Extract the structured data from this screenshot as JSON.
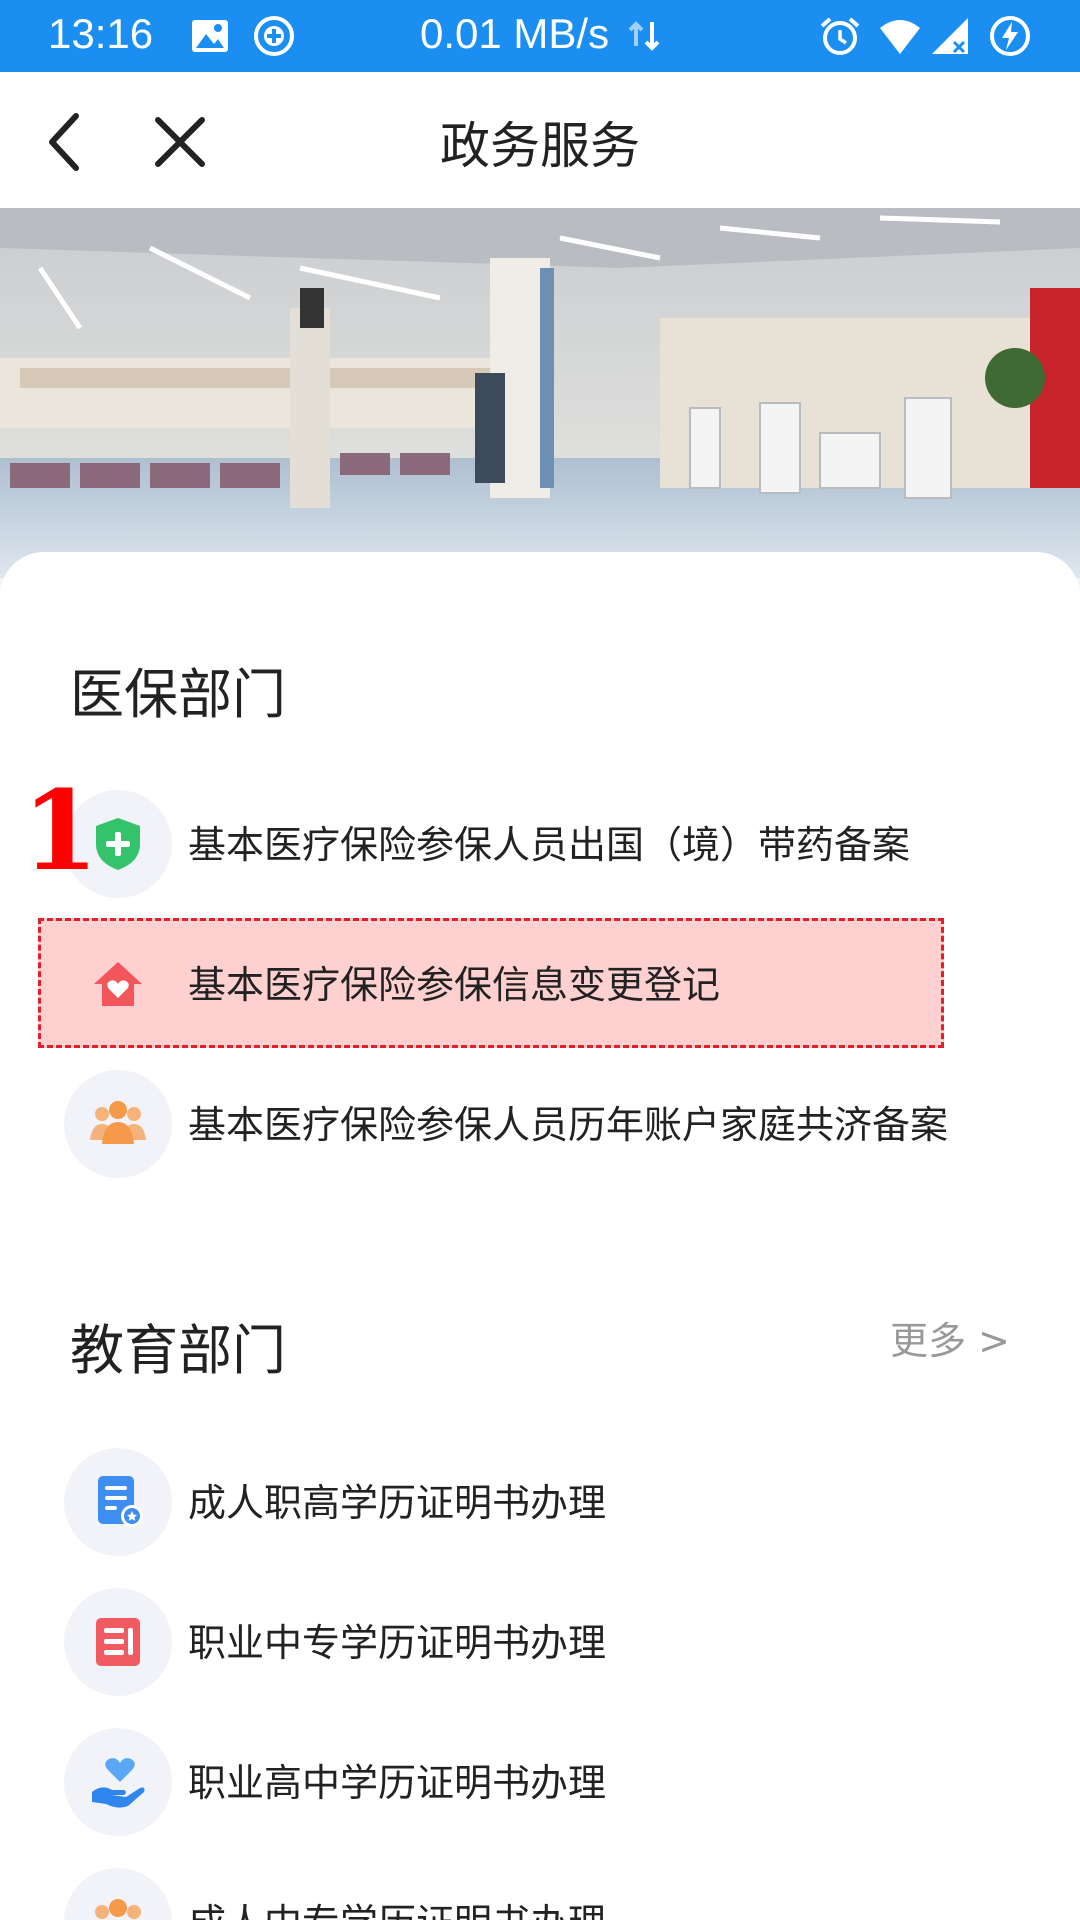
{
  "status_bar": {
    "time": "13:16",
    "network_speed": "0.01 MB/s",
    "icons": [
      "image-icon",
      "add-circle-icon",
      "data-arrows-icon",
      "alarm-icon",
      "wifi-icon",
      "signal-icon",
      "battery-charging-icon"
    ]
  },
  "title_bar": {
    "title": "政务服务",
    "back_icon": "chevron-left-icon",
    "close_icon": "close-icon"
  },
  "sections": [
    {
      "title": "医保部门",
      "more": "",
      "items": [
        {
          "label": "基本医疗保险参保人员出国（境）带药备案",
          "icon": "shield-plus-icon",
          "color": "#34c26b"
        },
        {
          "label": "基本医疗保险参保信息变更登记",
          "icon": "home-heart-icon",
          "color": "#f2555a"
        },
        {
          "label": "基本医疗保险参保人员历年账户家庭共济备案",
          "icon": "family-group-icon",
          "color": "#f59a4a"
        }
      ]
    },
    {
      "title": "教育部门",
      "more": "更多 >",
      "items": [
        {
          "label": "成人职高学历证明书办理",
          "icon": "document-badge-icon",
          "color": "#3d8ef0"
        },
        {
          "label": "职业中专学历证明书办理",
          "icon": "certificate-icon",
          "color": "#f25a62"
        },
        {
          "label": "职业高中学历证明书办理",
          "icon": "hand-heart-icon",
          "color": "#2f86ef"
        },
        {
          "label": "成人中专学历证明书办理",
          "icon": "family-group-icon",
          "color": "#f59a4a"
        }
      ]
    }
  ],
  "annotation": {
    "marker": "1",
    "highlight_color": "#e0202a"
  }
}
